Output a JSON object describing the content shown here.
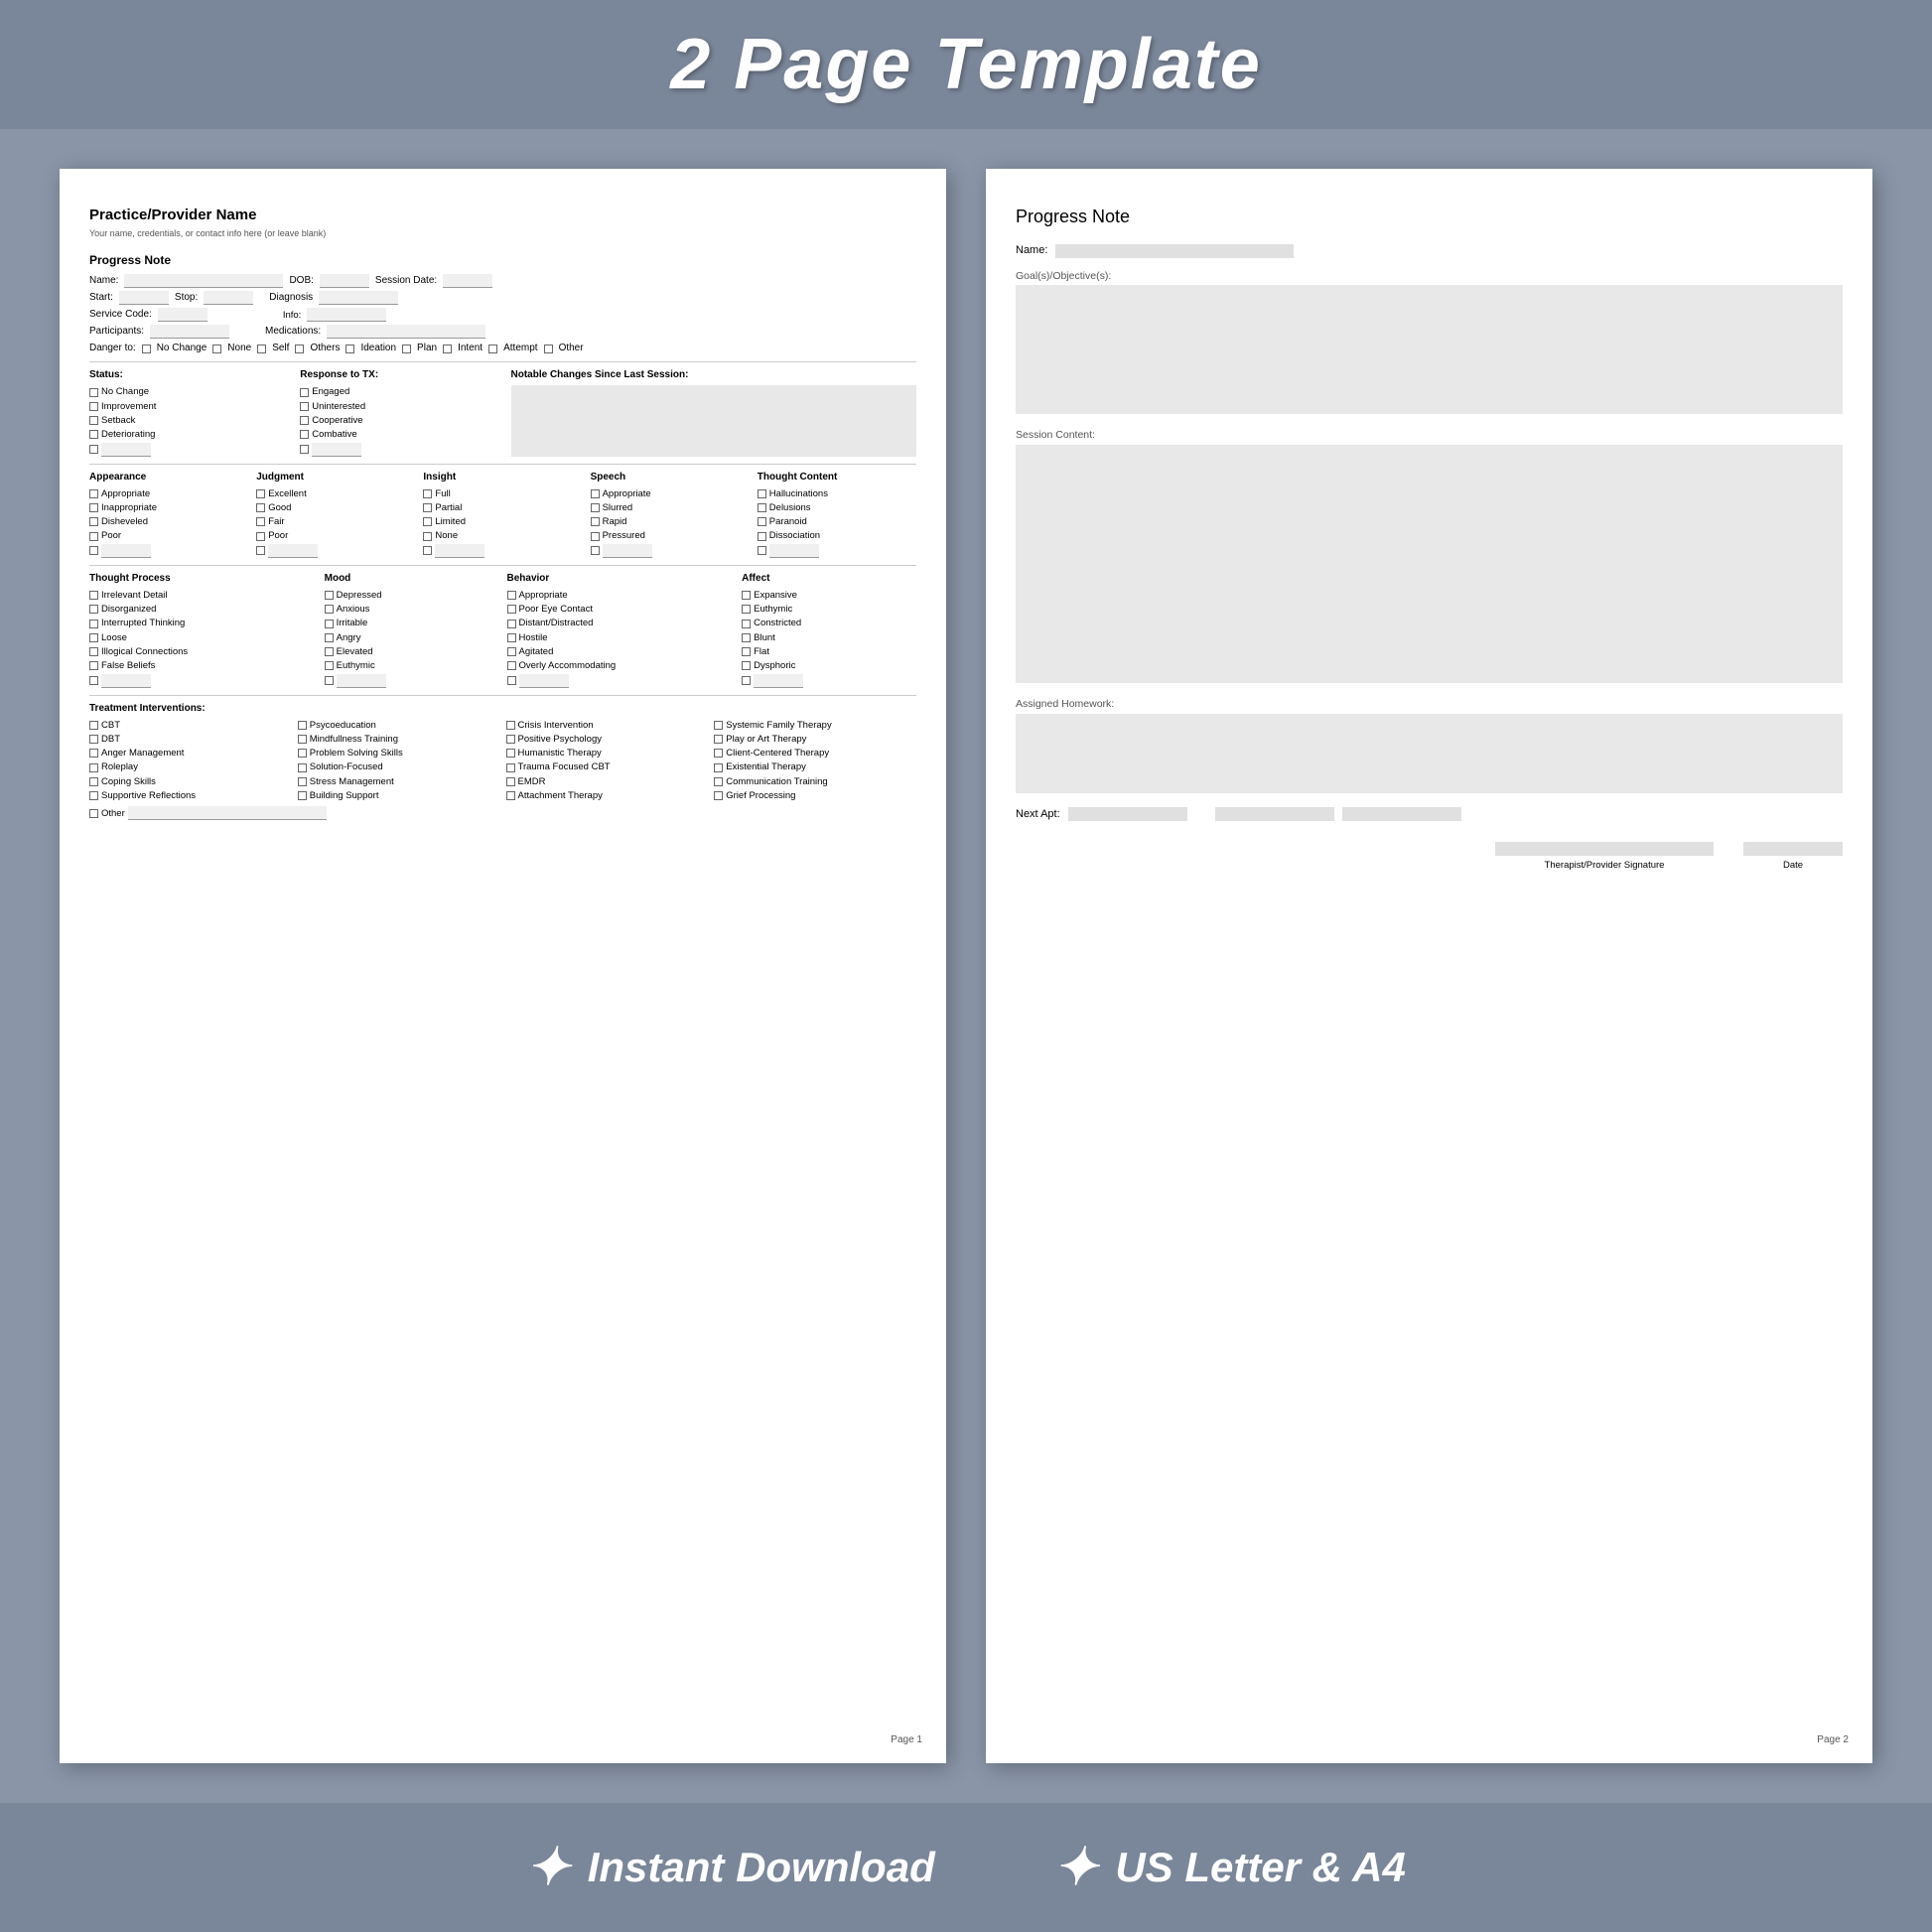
{
  "header": {
    "title": "2 Page Template"
  },
  "footer": {
    "item1": "Instant Download",
    "item2": "US Letter & A4"
  },
  "page1": {
    "practice_name": "Practice/Provider Name",
    "practice_sub": "Your name, credentials, or contact info here (or leave blank)",
    "section_title": "Progress Note",
    "fields": {
      "name_label": "Name:",
      "dob_label": "DOB:",
      "session_date_label": "Session Date:",
      "start_label": "Start:",
      "stop_label": "Stop:",
      "diagnosis_label": "Diagnosis Info:",
      "service_code_label": "Service Code:",
      "participants_label": "Participants:",
      "medications_label": "Medications:"
    },
    "danger": {
      "label": "Danger to:",
      "options": [
        "No Change",
        "None",
        "Self",
        "Others",
        "Ideation",
        "Plan",
        "Intent",
        "Attempt",
        "Other"
      ]
    },
    "status": {
      "label": "Status:",
      "options": [
        "No Change",
        "Improvement",
        "Setback",
        "Deteriorating",
        ""
      ]
    },
    "response": {
      "label": "Response to TX:",
      "options": [
        "Engaged",
        "Uninterested",
        "Cooperative",
        "Combative",
        ""
      ]
    },
    "notable": {
      "label": "Notable Changes Since Last Session:"
    },
    "appearance": {
      "title": "Appearance",
      "options": [
        "Appropriate",
        "Inappropriate",
        "Disheveled",
        "Poor",
        ""
      ]
    },
    "judgment": {
      "title": "Judgment",
      "options": [
        "Excellent",
        "Good",
        "Fair",
        "Poor",
        ""
      ]
    },
    "insight": {
      "title": "Insight",
      "options": [
        "Full",
        "Partial",
        "Limited",
        "None",
        ""
      ]
    },
    "speech": {
      "title": "Speech",
      "options": [
        "Appropriate",
        "Slurred",
        "Rapid",
        "Pressured",
        ""
      ]
    },
    "thought_content": {
      "title": "Thought Content",
      "options": [
        "Hallucinations",
        "Delusions",
        "Paranoid",
        "Dissociation",
        ""
      ]
    },
    "thought_process": {
      "title": "Thought Process",
      "options": [
        "Irrelevant Detail",
        "Disorganized",
        "Interrupted Thinking",
        "Loose",
        "Illogical Connections",
        "False Beliefs",
        ""
      ]
    },
    "mood": {
      "title": "Mood",
      "options": [
        "Depressed",
        "Anxious",
        "Irritable",
        "Angry",
        "Elevated",
        "Euthymic",
        ""
      ]
    },
    "behavior": {
      "title": "Behavior",
      "options": [
        "Appropriate",
        "Poor Eye Contact",
        "Distant/Distracted",
        "Hostile",
        "Agitated",
        "Overly Accommodating",
        ""
      ]
    },
    "affect": {
      "title": "Affect",
      "options": [
        "Expansive",
        "Euthymic",
        "Constricted",
        "Blunt",
        "Flat",
        "Dysphoric",
        ""
      ]
    },
    "treatment": {
      "title": "Treatment Interventions:",
      "col1": [
        "CBT",
        "DBT",
        "Anger Management",
        "Roleplay",
        "Coping Skills",
        "Supportive Reflections"
      ],
      "col2": [
        "Psycoeducation",
        "Mindfullness Training",
        "Problem Solving Skills",
        "Solution-Focused",
        "Stress Management",
        "Building Support"
      ],
      "col3": [
        "Crisis Intervention",
        "Positive Psychology",
        "Humanistic Therapy",
        "Trauma Focused CBT",
        "EMDR",
        "Attachment Therapy"
      ],
      "col4": [
        "Systemic Family Therapy",
        "Play or Art Therapy",
        "Client-Centered Therapy",
        "Existential Therapy",
        "Communication Training",
        "Grief Processing"
      ]
    },
    "other_label": "Other",
    "page_num": "Page 1"
  },
  "page2": {
    "title": "Progress Note",
    "name_label": "Name:",
    "goals_label": "Goal(s)/Objective(s):",
    "session_content_label": "Session Content:",
    "assigned_homework_label": "Assigned Homework:",
    "next_apt_label": "Next Apt:",
    "therapist_sig_label": "Therapist/Provider Signature",
    "date_label": "Date",
    "page_num": "Page 2"
  }
}
